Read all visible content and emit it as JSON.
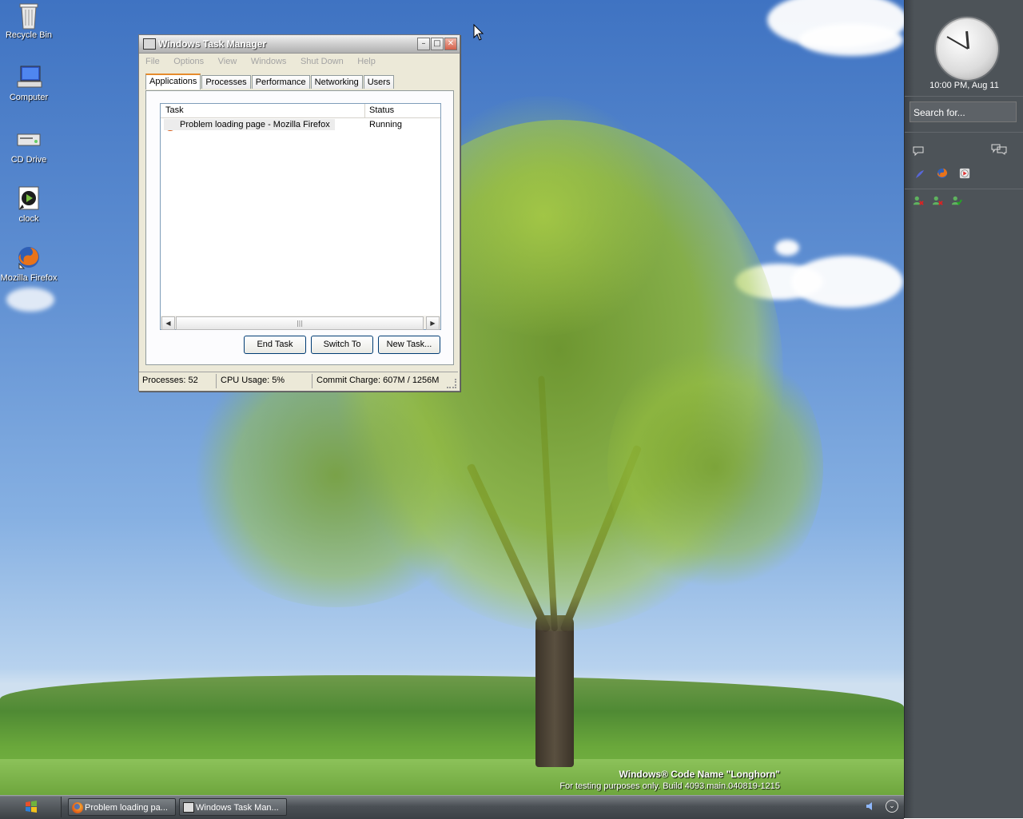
{
  "desktop": {
    "icons": [
      {
        "label": "Recycle Bin"
      },
      {
        "label": "Computer"
      },
      {
        "label": "CD Drive"
      },
      {
        "label": "clock"
      },
      {
        "label": "Mozilla Firefox"
      }
    ],
    "watermark": {
      "line1": "Windows® Code Name \"Longhorn\"",
      "line2": "For testing purposes only. Build 4093.main.040819-1215"
    }
  },
  "task_manager": {
    "title": "Windows Task Manager",
    "menu": [
      "File",
      "Options",
      "View",
      "Windows",
      "Shut Down",
      "Help"
    ],
    "tabs": [
      "Applications",
      "Processes",
      "Performance",
      "Networking",
      "Users"
    ],
    "active_tab": "Applications",
    "columns": {
      "task": "Task",
      "status": "Status"
    },
    "rows": [
      {
        "task": "Problem loading page - Mozilla Firefox",
        "status": "Running",
        "icon": "firefox-icon"
      }
    ],
    "buttons": {
      "end_task": "End Task",
      "switch_to": "Switch To",
      "new_task": "New Task..."
    },
    "status_bar": {
      "processes": "Processes: 52",
      "cpu": "CPU Usage: 5%",
      "commit": "Commit Charge: 607M / 1256M"
    }
  },
  "sidebar": {
    "clock_text": "10:00 PM, Aug 11",
    "search_placeholder": "Search for..."
  },
  "taskbar": {
    "buttons": [
      {
        "label": "Problem loading pa...",
        "icon": "firefox-icon"
      },
      {
        "label": "Windows Task Man...",
        "icon": "task-manager-icon"
      }
    ]
  },
  "colors": {
    "sky": "#5f8fd2",
    "sidebar": "#4d5358",
    "window": "#ece9d8",
    "tab_accent": "#e68b2c"
  }
}
